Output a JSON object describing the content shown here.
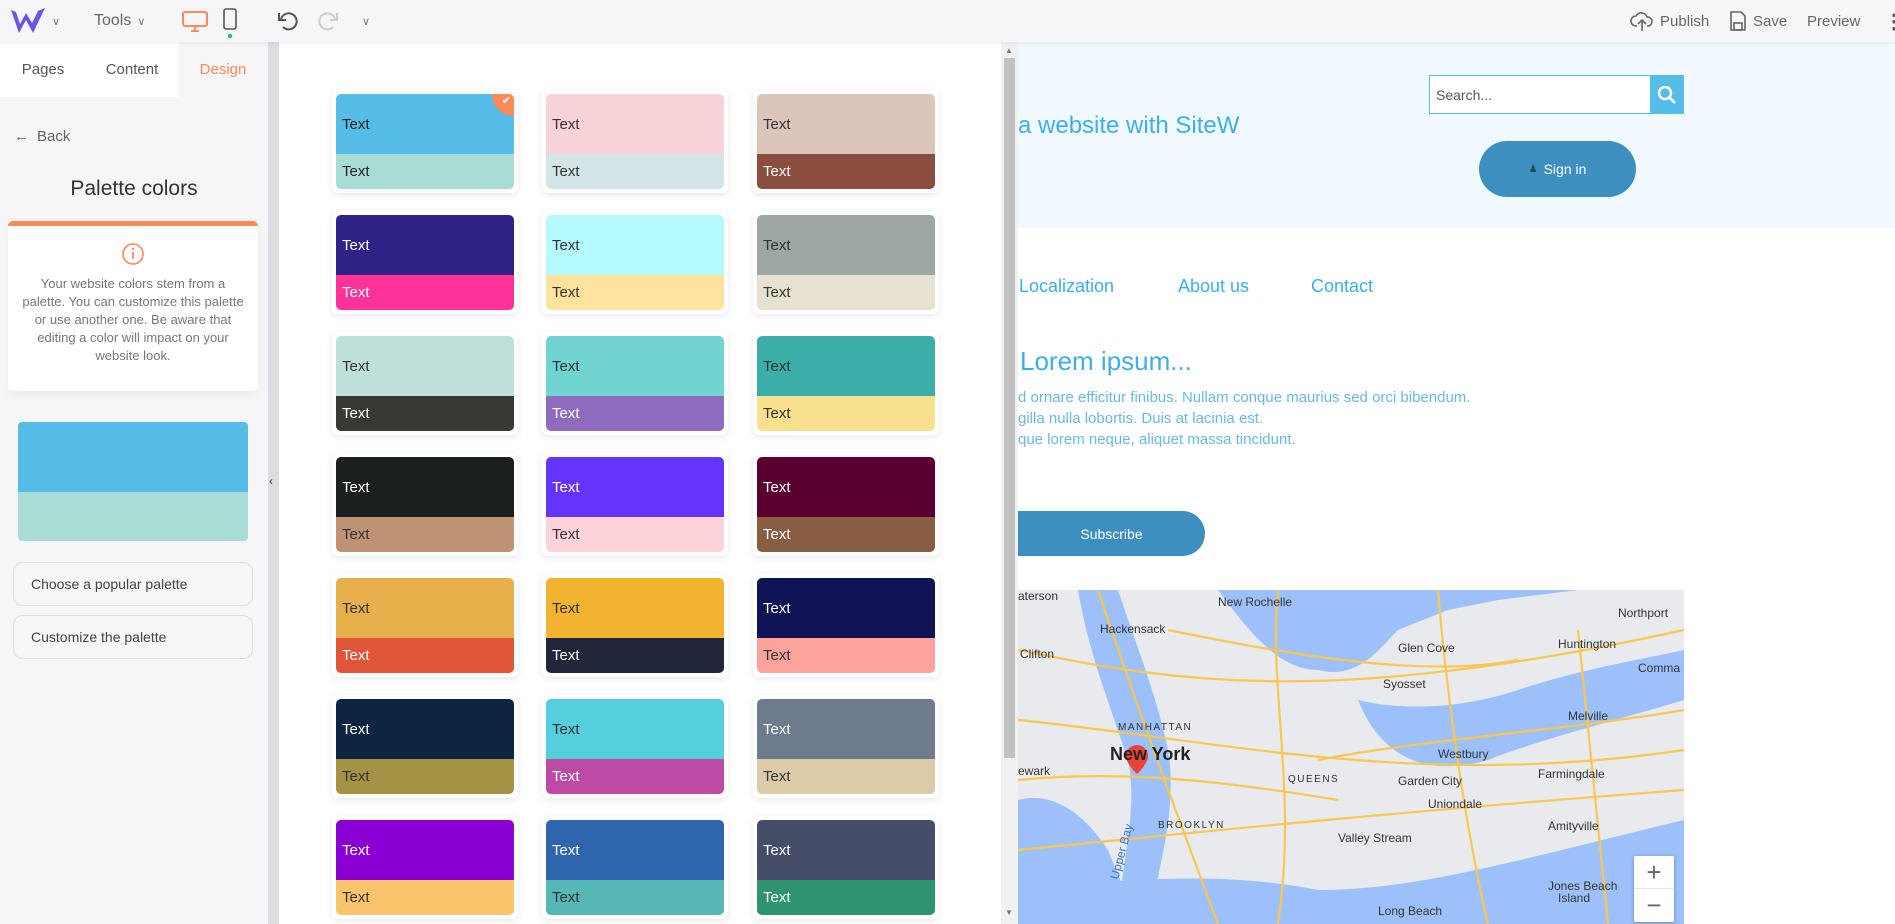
{
  "topbar": {
    "tools_label": "Tools",
    "publish_label": "Publish",
    "save_label": "Save",
    "preview_label": "Preview",
    "icons": [
      "sitew-logo",
      "chevron-down-icon",
      "desktop-icon",
      "mobile-icon",
      "undo-icon",
      "redo-icon",
      "cloud-upload-icon",
      "save-icon",
      "more-vertical-icon"
    ],
    "accent": "#ff8a57"
  },
  "sidebar": {
    "tabs": [
      {
        "label": "Pages"
      },
      {
        "label": "Content"
      },
      {
        "label": "Design",
        "active": true
      }
    ],
    "back_label": "Back",
    "title": "Palette colors",
    "info_text": "Your website colors stem from a palette. You can customize this palette or use another one. Be aware that editing a color will impact on your website look.",
    "current_palette": {
      "primary": "#56bde8",
      "secondary": "#a8dcd5"
    },
    "buttons": [
      {
        "label": "Choose a popular palette"
      },
      {
        "label": "Customize the palette"
      }
    ]
  },
  "palettes": {
    "sample_text": "Text",
    "selected_index": 0,
    "items": [
      {
        "top": "#56bde8",
        "bottom": "#a8dcd5",
        "top_text": "#222",
        "bottom_text": "#222"
      },
      {
        "top": "#f7d3d7",
        "bottom": "#d3e5e6",
        "top_text": "#333",
        "bottom_text": "#333"
      },
      {
        "top": "#dcc6bc",
        "bottom": "#8a4d3f",
        "top_text": "#333",
        "bottom_text": "#fff"
      },
      {
        "top": "#2e2287",
        "bottom": "#ff3399",
        "top_text": "#fff",
        "bottom_text": "#fff"
      },
      {
        "top": "#b4fafc",
        "bottom": "#fee29d",
        "top_text": "#333",
        "bottom_text": "#333"
      },
      {
        "top": "#9da8a2",
        "bottom": "#e6e1d1",
        "top_text": "#333",
        "bottom_text": "#333"
      },
      {
        "top": "#bfe0da",
        "bottom": "#3a3835",
        "top_text": "#333",
        "bottom_text": "#fff"
      },
      {
        "top": "#70d4d0",
        "bottom": "#8e6bbf",
        "top_text": "#333",
        "bottom_text": "#fff"
      },
      {
        "top": "#3caea9",
        "bottom": "#f8e08e",
        "top_text": "#333",
        "bottom_text": "#333"
      },
      {
        "top": "#1b1f1f",
        "bottom": "#c09275",
        "top_text": "#fff",
        "bottom_text": "#333"
      },
      {
        "top": "#6434fc",
        "bottom": "#fdd2d9",
        "top_text": "#fff",
        "bottom_text": "#333"
      },
      {
        "top": "#5a0030",
        "bottom": "#895d44",
        "top_text": "#fff",
        "bottom_text": "#fff"
      },
      {
        "top": "#e8b04a",
        "bottom": "#e05438",
        "top_text": "#333",
        "bottom_text": "#fff"
      },
      {
        "top": "#f2b430",
        "bottom": "#22263a",
        "top_text": "#333",
        "bottom_text": "#fff"
      },
      {
        "top": "#0f1255",
        "bottom": "#fea39c",
        "top_text": "#fff",
        "bottom_text": "#333"
      },
      {
        "top": "#0d2543",
        "bottom": "#a69245",
        "top_text": "#fff",
        "bottom_text": "#333"
      },
      {
        "top": "#55cfdd",
        "bottom": "#bd4ba6",
        "top_text": "#333",
        "bottom_text": "#fff"
      },
      {
        "top": "#6d7b8d",
        "bottom": "#dccaa8",
        "top_text": "#fff",
        "bottom_text": "#333"
      },
      {
        "top": "#8a00d4",
        "bottom": "#f9c56c",
        "top_text": "#fff",
        "bottom_text": "#333"
      },
      {
        "top": "#2f65ad",
        "bottom": "#57b6b6",
        "top_text": "#fff",
        "bottom_text": "#333"
      },
      {
        "top": "#464d68",
        "bottom": "#2e9470",
        "top_text": "#fff",
        "bottom_text": "#fff"
      }
    ]
  },
  "preview": {
    "site_title": "a website with SiteW",
    "search_placeholder": "Search...",
    "signin_label": "Sign in",
    "nav": [
      "Localization",
      "About us",
      "Contact"
    ],
    "heading": "Lorem ipsum...",
    "paragraph": [
      "d ornare efficitur finibus. Nullam conque maurius sed orci bibendum.",
      "gilla nulla lobortis. Duis at lacinia est.",
      "que lorem neque, aliquet massa tincidunt."
    ],
    "subscribe_label": "Subscribe",
    "button_color": "#3d8fc0",
    "text_color": "#3daee9",
    "map": {
      "marker_label": "New York",
      "labels": [
        "aterson",
        "Hackensack",
        "New Rochelle",
        "Northport",
        "Clifton",
        "Glen Cove",
        "Huntington",
        "Comma",
        "Syosset",
        "MANHATTAN",
        "Melville",
        "Westbury",
        "ewark",
        "QUEENS",
        "Garden City",
        "Farmingdale",
        "BROOKLYN",
        "Uniondale",
        "Amityville",
        "Valley Stream",
        "Upper Bay",
        "Jones Beach",
        "Island",
        "Long Beach"
      ],
      "zoom_in": "+",
      "zoom_out": "−"
    }
  }
}
